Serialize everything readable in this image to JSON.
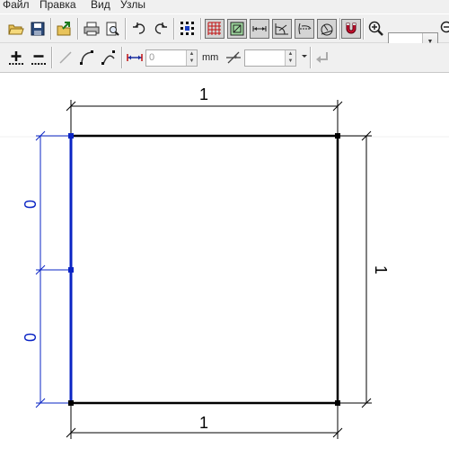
{
  "menu": {
    "file": "Файл",
    "edit": "Правка",
    "view": "Вид",
    "nodes": "Узлы"
  },
  "toolbar2": {
    "length_value": "0",
    "length_unit": "mm",
    "angle_value": ""
  },
  "drawing": {
    "dim_top": "1",
    "dim_bottom": "1",
    "dim_right": "1",
    "dim_left_upper": "0",
    "dim_left_lower": "0",
    "colors": {
      "outline": "#000000",
      "selected_edge": "#0a24c4",
      "dimension_selected": "#0a24c4",
      "magnet_button": "#c8102e"
    }
  }
}
